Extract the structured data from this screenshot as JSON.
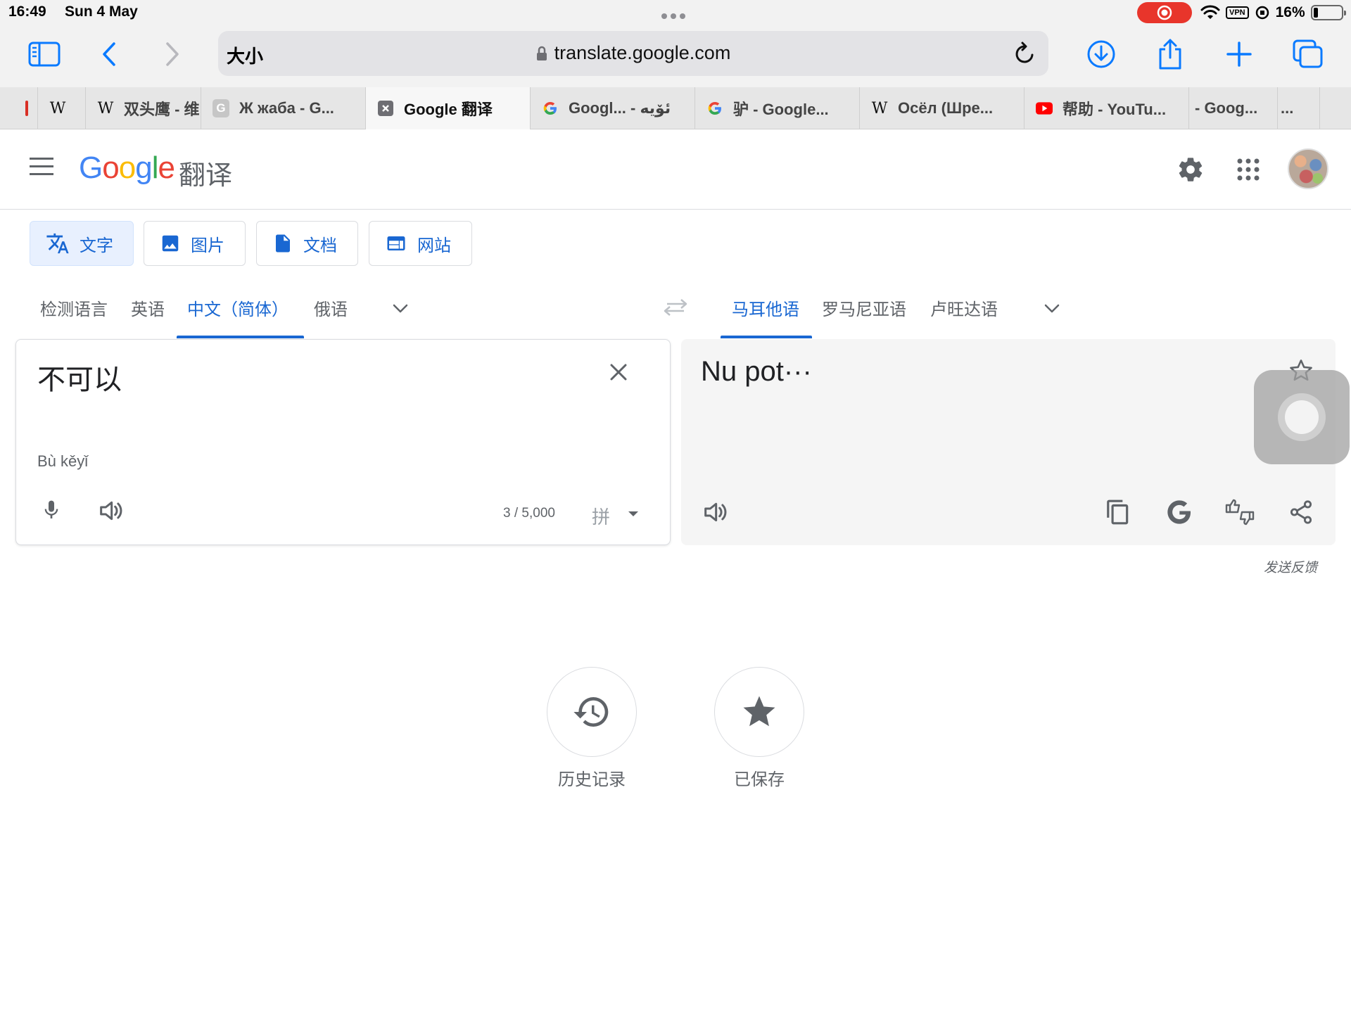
{
  "status_bar": {
    "time": "16:49",
    "date": "Sun 4 May",
    "vpn": "VPN",
    "battery_percent": "16%",
    "battery_level": 0.16
  },
  "browser": {
    "text_size_label": "大小",
    "url": "translate.google.com",
    "tabs": [
      {
        "title": "",
        "favicon": "red-favicon"
      },
      {
        "title": "",
        "favicon": "W"
      },
      {
        "title": "双头鹰 - 维",
        "favicon": "W"
      },
      {
        "title": "Ж жаба - G...",
        "favicon": "G"
      },
      {
        "title": "Google 翻译",
        "favicon": "translate-favicon",
        "active": true
      },
      {
        "title": "Googl... - ئۆيە",
        "favicon": "google-g"
      },
      {
        "title": "驴 - Google...",
        "favicon": "google-g"
      },
      {
        "title": "Осёл (Шре...",
        "favicon": "W"
      },
      {
        "title": "帮助 - YouTu...",
        "favicon": "youtube"
      },
      {
        "title": "- Goog...",
        "favicon": ""
      },
      {
        "title": "...",
        "favicon": ""
      }
    ]
  },
  "header": {
    "logo": "Google",
    "logo_suffix": "翻译"
  },
  "modes": [
    {
      "label": "文字",
      "active": true
    },
    {
      "label": "图片"
    },
    {
      "label": "文档"
    },
    {
      "label": "网站"
    }
  ],
  "source_langs": [
    "检测语言",
    "英语",
    "中文（简体）",
    "俄语"
  ],
  "source_selected": "中文（简体）",
  "target_langs": [
    "马耳他语",
    "罗马尼亚语",
    "卢旺达语"
  ],
  "target_selected": "马耳他语",
  "source": {
    "text": "不可以",
    "romanization": "Bù kěyǐ",
    "char_count": "3 / 5,000",
    "ime": "拼"
  },
  "target": {
    "text": "Nu pot···"
  },
  "feedback": "发送反馈",
  "bottom": {
    "history_label": "历史记录",
    "saved_label": "已保存"
  },
  "colors": {
    "accent": "#1967d2",
    "recording": "#e8352b",
    "safari_blue": "#0a7aff"
  }
}
